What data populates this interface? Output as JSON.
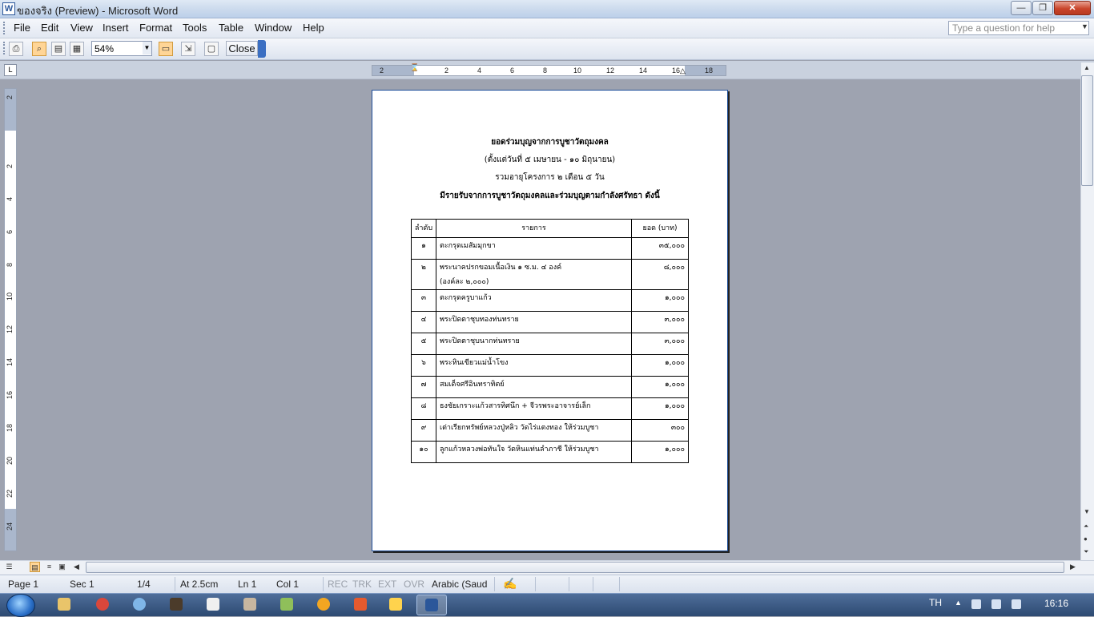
{
  "window": {
    "icon_label": "W",
    "title": "ของจริง (Preview) - Microsoft Word",
    "min": "—",
    "max": "❐",
    "close": "✕"
  },
  "menu": {
    "items": [
      "File",
      "Edit",
      "View",
      "Insert",
      "Format",
      "Tools",
      "Table",
      "Window",
      "Help"
    ],
    "help_placeholder": "Type a question for help"
  },
  "toolbar": {
    "zoom": "54%",
    "close_label": "Close"
  },
  "ruler": {
    "h_ticks": [
      "2",
      "2",
      "4",
      "6",
      "8",
      "10",
      "12",
      "14",
      "16",
      "18"
    ],
    "v_ticks": [
      "2",
      "2",
      "4",
      "6",
      "8",
      "10",
      "12",
      "14",
      "16",
      "18",
      "20",
      "22",
      "24"
    ]
  },
  "document": {
    "line1": "ยอดร่วมบุญจากการบูชาวัตถุมงคล",
    "line2": "(ตั้งแต่วันที่ ๕ เมษายน - ๑๐ มิถุนายน)",
    "line3": "รวมอายุโครงการ ๒ เดือน ๕ วัน",
    "line4": "มีรายรับจากการบูชาวัตถุมงคลและร่วมบุญตามกำลังศรัทธา ดังนี้",
    "table_headers": {
      "no": "ลำดับ",
      "item": "รายการ",
      "amount": "ยอด (บาท)"
    },
    "rows": [
      {
        "no": "๑",
        "item": "ตะกรุดเมสัมมุกขา",
        "amount": "๓๕,๐๐๐"
      },
      {
        "no": "๒",
        "item": "พระนาคปรกขอมเนื้อเงิน ๑ ซ.ม. ๔ องค์",
        "item2": "(องค์ละ ๒,๐๐๐)",
        "amount": "๘,๐๐๐"
      },
      {
        "no": "๓",
        "item": "ตะกรุดครูบาแก้ว",
        "amount": "๑,๐๐๐"
      },
      {
        "no": "๔",
        "item": "พระปิดตาชุบทองท่นทราย",
        "amount": "๓,๐๐๐"
      },
      {
        "no": "๕",
        "item": "พระปิดตาชุบนากท่นทราย",
        "amount": "๓,๐๐๐"
      },
      {
        "no": "๖",
        "item": "พระหินเขียวแม่น้ำโขง",
        "amount": "๑,๐๐๐"
      },
      {
        "no": "๗",
        "item": "สมเด็จศรีอินทราทิตย์",
        "amount": "๑,๐๐๐"
      },
      {
        "no": "๘",
        "item": "ธงชัยเกราะแก้วสารทิศนึก + จีวรพระอาจารย์เล็ก",
        "amount": "๑,๐๐๐"
      },
      {
        "no": "๙",
        "item": "เต่าเรียกทรัพย์หลวงปู่หลิว วัดไร่แตงทอง ให้ร่วมบูชา",
        "amount": "๓๐๐"
      },
      {
        "no": "๑๐",
        "item": "ลูกแก้วหลวงพ่อทันใจ วัดหินแท่นลำภาชี ให้ร่วมบูชา",
        "amount": "๑,๐๐๐"
      }
    ]
  },
  "status": {
    "page": "Page 1",
    "sec": "Sec 1",
    "pages": "1/4",
    "at": "At 2.5cm",
    "ln": "Ln 1",
    "col": "Col 1",
    "rec": "REC",
    "trk": "TRK",
    "ext": "EXT",
    "ovr": "OVR",
    "lang": "Arabic (Saud"
  },
  "taskbar": {
    "lang": "TH",
    "time": "16:16"
  },
  "colors": {
    "accent": "#1f4f9a",
    "app_bg": "#9ea3b0"
  }
}
